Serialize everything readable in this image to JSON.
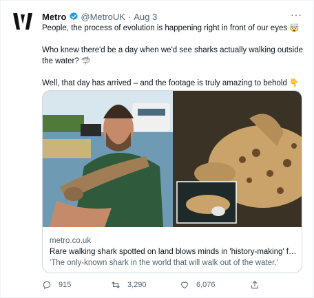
{
  "tweet": {
    "author_name": "Metro",
    "handle": "@MetroUK",
    "separator": "·",
    "date": "Aug 3",
    "more_label": "···",
    "lines": [
      "People, the process of evolution is happening right in front of our eyes 🤯",
      "Who knew there'd be a day when we'd see sharks actually walking outside",
      "the water? 🦈",
      "Well, that day has arrived – and the footage is truly amazing to behold 👇"
    ]
  },
  "card": {
    "domain": "metro.co.uk",
    "title": "Rare walking shark spotted on land blows minds in 'history-making' fo...",
    "description": "'The only-known shark in the world that will walk out of the water.'"
  },
  "actions": {
    "replies": "915",
    "retweets": "3,290",
    "likes": "6,076"
  },
  "colors": {
    "accent": "#1d9bf0",
    "muted": "#536471",
    "text": "#0f1419",
    "border": "#cfd9de"
  },
  "icons": [
    "metro-logo-icon",
    "verified-badge-icon",
    "more-icon",
    "reply-icon",
    "retweet-icon",
    "like-icon",
    "share-icon"
  ]
}
